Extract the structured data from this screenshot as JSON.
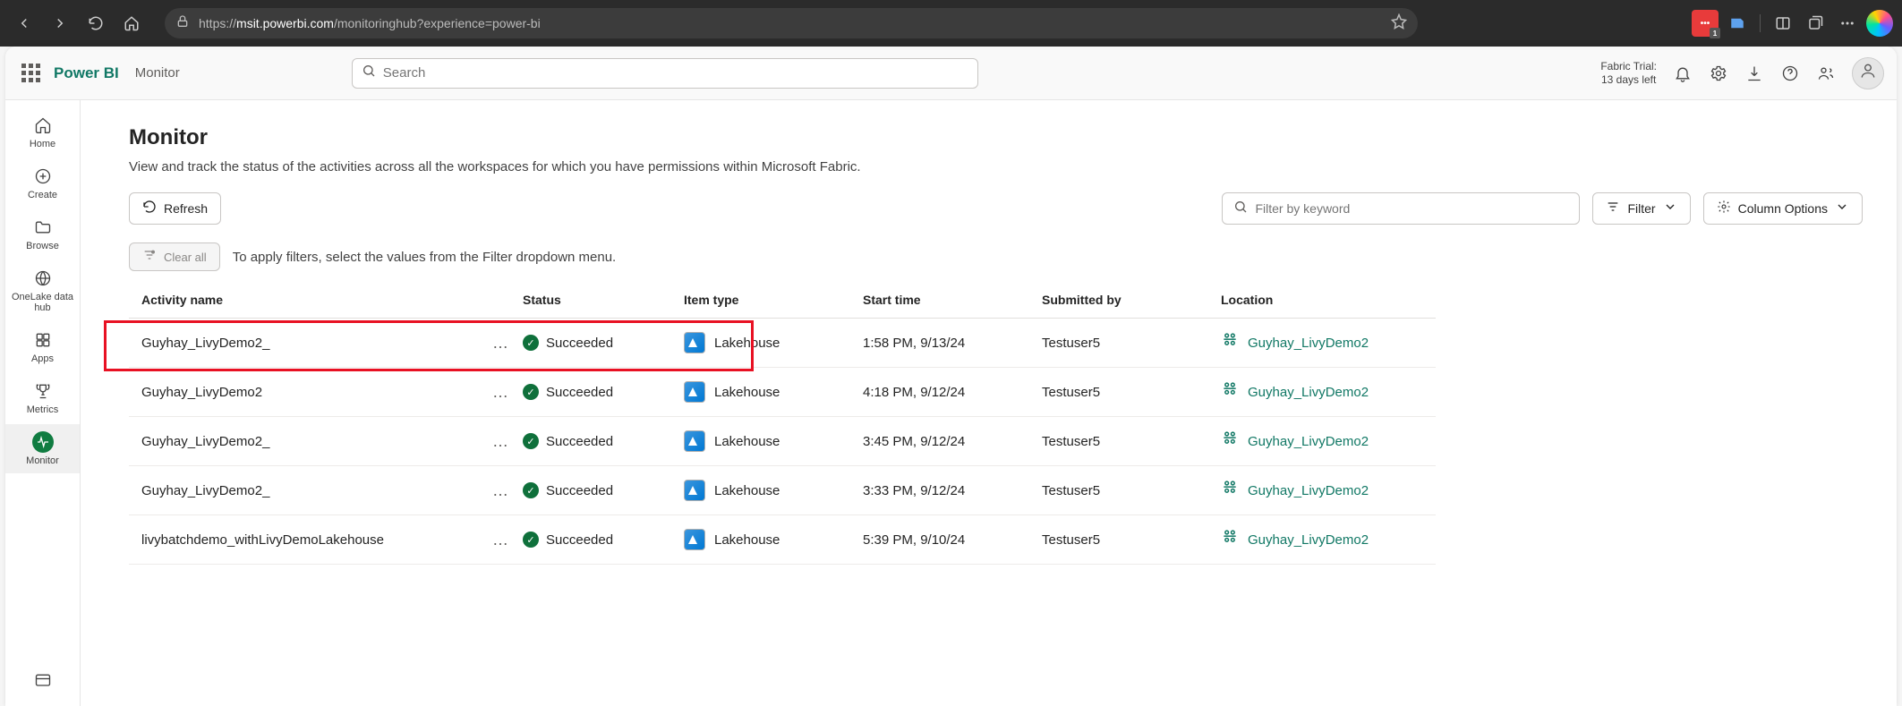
{
  "browser": {
    "url_prefix": "https://",
    "url_domain": "msit.powerbi.com",
    "url_path": "/monitoringhub?experience=power-bi",
    "ext_badge": "1"
  },
  "suite": {
    "brand": "Power BI",
    "crumb": "Monitor",
    "search_placeholder": "Search",
    "trial_line1": "Fabric Trial:",
    "trial_line2": "13 days left"
  },
  "rail": {
    "items": [
      {
        "label": "Home",
        "icon": "home"
      },
      {
        "label": "Create",
        "icon": "plus-circle"
      },
      {
        "label": "Browse",
        "icon": "folder"
      },
      {
        "label": "OneLake data hub",
        "icon": "onelake"
      },
      {
        "label": "Apps",
        "icon": "apps"
      },
      {
        "label": "Metrics",
        "icon": "trophy"
      },
      {
        "label": "Monitor",
        "icon": "pulse",
        "active": true
      }
    ]
  },
  "page": {
    "title": "Monitor",
    "description": "View and track the status of the activities across all the workspaces for which you have permissions within Microsoft Fabric.",
    "refresh": "Refresh",
    "filter_placeholder": "Filter by keyword",
    "filter_btn": "Filter",
    "col_options": "Column Options",
    "clear_all": "Clear all",
    "filter_hint": "To apply filters, select the values from the Filter dropdown menu."
  },
  "table": {
    "headers": {
      "activity": "Activity name",
      "status": "Status",
      "item": "Item type",
      "start": "Start time",
      "submitted": "Submitted by",
      "location": "Location"
    },
    "rows": [
      {
        "name": "Guyhay_LivyDemo2_",
        "status": "Succeeded",
        "item": "Lakehouse",
        "start": "1:58 PM, 9/13/24",
        "sub": "Testuser5",
        "loc": "Guyhay_LivyDemo2",
        "highlight": true
      },
      {
        "name": "Guyhay_LivyDemo2",
        "status": "Succeeded",
        "item": "Lakehouse",
        "start": "4:18 PM, 9/12/24",
        "sub": "Testuser5",
        "loc": "Guyhay_LivyDemo2"
      },
      {
        "name": "Guyhay_LivyDemo2_",
        "status": "Succeeded",
        "item": "Lakehouse",
        "start": "3:45 PM, 9/12/24",
        "sub": "Testuser5",
        "loc": "Guyhay_LivyDemo2"
      },
      {
        "name": "Guyhay_LivyDemo2_",
        "status": "Succeeded",
        "item": "Lakehouse",
        "start": "3:33 PM, 9/12/24",
        "sub": "Testuser5",
        "loc": "Guyhay_LivyDemo2"
      },
      {
        "name": "livybatchdemo_withLivyDemoLakehouse",
        "status": "Succeeded",
        "item": "Lakehouse",
        "start": "5:39 PM, 9/10/24",
        "sub": "Testuser5",
        "loc": "Guyhay_LivyDemo2"
      }
    ]
  }
}
